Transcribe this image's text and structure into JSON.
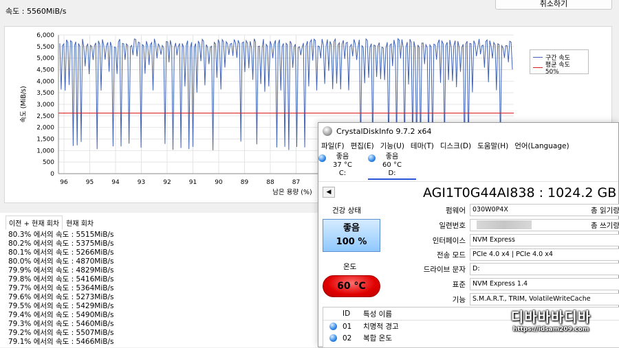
{
  "speed_label": "속도 : 5560MiB/s",
  "cancel_label": "취소하기",
  "chart_data": {
    "type": "line",
    "title": "",
    "xlabel": "남은 용량 (%)",
    "ylabel": "속도 (MiB/s)",
    "x_ticks": [
      "96",
      "95",
      "94",
      "93",
      "92",
      "91",
      "90",
      "89",
      "88",
      "87"
    ],
    "y_ticks": [
      "6,000",
      "5,500",
      "5,000",
      "4,500",
      "4,000",
      "3,500",
      "3,000",
      "2,500",
      "2,000",
      "1,500",
      "1,000",
      "500",
      "0"
    ],
    "ylim": [
      0,
      6000
    ],
    "grid": true,
    "legend_position": "top-right",
    "series": [
      {
        "name": "구간 속도",
        "color": "#3f62b4",
        "typical_value": 5560,
        "dip_value": 1000
      },
      {
        "name": "평균 속도 50%",
        "color": "#d92020",
        "values": [
          2620
        ]
      }
    ]
  },
  "tabs": [
    "이전 + 현재 회차",
    "현재 회차"
  ],
  "log": [
    "80.3% 에서의 속도 : 5515MiB/s",
    "80.2% 에서의 속도 : 5375MiB/s",
    "80.1% 에서의 속도 : 5266MiB/s",
    "80.0% 에서의 속도 : 4870MiB/s",
    "79.9% 에서의 속도 : 4829MiB/s",
    "79.8% 에서의 속도 : 5416MiB/s",
    "79.7% 에서의 속도 : 5364MiB/s",
    "79.6% 에서의 속도 : 5273MiB/s",
    "79.5% 에서의 속도 : 5429MiB/s",
    "79.4% 에서의 속도 : 5490MiB/s",
    "79.3% 에서의 속도 : 5460MiB/s",
    "79.2% 에서의 속도 : 5507MiB/s",
    "79.1% 에서의 속도 : 5466MiB/s"
  ],
  "cdi": {
    "title": "CrystalDiskInfo 9.7.2 x64",
    "menu": [
      "파일(F)",
      "편집(E)",
      "기능(U)",
      "테마(T)",
      "디스크(D)",
      "도움말(H)",
      "언어(Language)"
    ],
    "drives": [
      {
        "status": "좋음",
        "temp": "37 °C",
        "letter": "C:"
      },
      {
        "status": "좋음",
        "temp": "60 °C",
        "letter": "D:"
      }
    ],
    "model": "AGI1T0G44AI838 : 1024.2 GB",
    "health_label": "건강 상태",
    "health_status": "좋음",
    "health_pct": "100 %",
    "temp_label": "온도",
    "temp_value": "60 °C",
    "fields": {
      "firmware_label": "펌웨어",
      "firmware": "030W0P4X",
      "serial_label": "일련번호",
      "serial": "",
      "interface_label": "인터페이스",
      "interface": "NVM Express",
      "transfer_label": "전송 모드",
      "transfer": "PCIe 4.0 x4 | PCIe 4.0 x4",
      "letter_label": "드라이브 문자",
      "letter": "D:",
      "standard_label": "표준",
      "standard": "NVM Express 1.4",
      "features_label": "기능",
      "features": "S.M.A.R.T., TRIM, VolatileWriteCache"
    },
    "right_labels": [
      "총 읽기량",
      "총 쓰기량"
    ],
    "attr_headers": [
      "ID",
      "특성 이름"
    ],
    "attrs": [
      {
        "id": "01",
        "name": "치명적 경고"
      },
      {
        "id": "02",
        "name": "복합 온도"
      }
    ],
    "colors": {
      "health": "#8fc8ff",
      "temp": "#e00000",
      "dot": "#2f86e6"
    }
  },
  "watermark": {
    "main": "디바바바디바",
    "url": "https://idsam209.com"
  }
}
